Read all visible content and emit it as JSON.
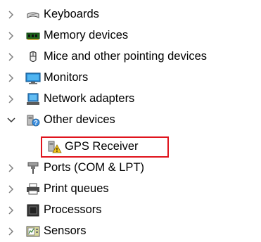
{
  "tree": {
    "items": [
      {
        "label": "Keyboards",
        "icon": "keyboard-icon",
        "expanded": false
      },
      {
        "label": "Memory devices",
        "icon": "memory-chip-icon",
        "expanded": false
      },
      {
        "label": "Mice and other pointing devices",
        "icon": "mouse-icon",
        "expanded": false
      },
      {
        "label": "Monitors",
        "icon": "monitor-icon",
        "expanded": false
      },
      {
        "label": "Network adapters",
        "icon": "network-adapter-icon",
        "expanded": false
      },
      {
        "label": "Other devices",
        "icon": "unknown-device-icon",
        "expanded": true,
        "children": [
          {
            "label": "GPS Receiver",
            "icon": "warning-device-icon",
            "highlighted": true
          }
        ]
      },
      {
        "label": "Ports (COM & LPT)",
        "icon": "port-connector-icon",
        "expanded": false
      },
      {
        "label": "Print queues",
        "icon": "printer-icon",
        "expanded": false
      },
      {
        "label": "Processors",
        "icon": "processor-icon",
        "expanded": false
      },
      {
        "label": "Sensors",
        "icon": "sensor-icon",
        "expanded": false
      }
    ]
  },
  "colors": {
    "highlight_border": "#e0141d",
    "chevron": "#808080"
  }
}
